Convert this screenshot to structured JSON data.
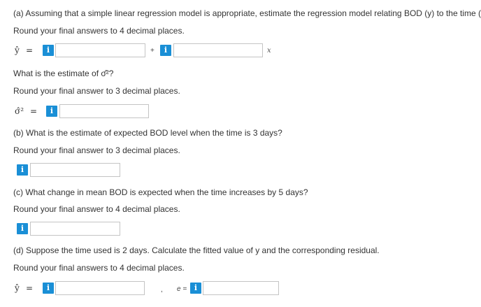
{
  "part_a": {
    "prompt": "(a) Assuming that a simple linear regression model is appropriate, estimate the regression model relating BOD (y) to the time (x).",
    "round_note": "Round your final answers to 4 decimal places.",
    "yhat_symbol": "ŷ",
    "equals": "=",
    "plus": "+",
    "x_symbol": "x",
    "intercept_value": "",
    "slope_value": "",
    "sigma_prompt": "What is the estimate of σ̂²?",
    "sigma_round_note": "Round your final answer to 3 decimal places.",
    "sigma_symbol": "σ̂²",
    "sigma_value": ""
  },
  "part_b": {
    "prompt": "(b) What is the estimate of expected BOD level when the time is 3 days?",
    "round_note": "Round your final answer to 3 decimal places.",
    "value": ""
  },
  "part_c": {
    "prompt": "(c) What change in mean BOD is expected when the time increases by 5 days?",
    "round_note": "Round your final answer to 4 decimal places.",
    "value": ""
  },
  "part_d": {
    "prompt": "(d) Suppose the time used is 2 days. Calculate the fitted value of y and the corresponding residual.",
    "round_note": "Round your final answers to 4 decimal places.",
    "yhat_symbol": "ŷ",
    "equals": "=",
    "comma": ",",
    "e_label": "e =",
    "fitted_value": "",
    "residual_value": ""
  },
  "info_icon_glyph": "i"
}
